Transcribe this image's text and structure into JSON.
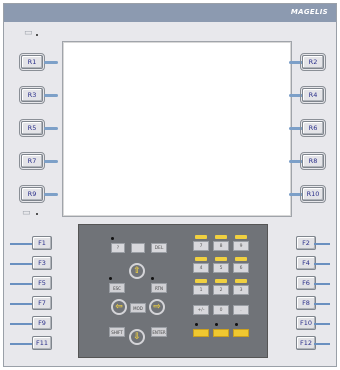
{
  "brand": "MAGELIS",
  "icons": {
    "screen_icon": "display-icon",
    "keyboard_icon": "keyboard-icon"
  },
  "colors": {
    "topbar": "#8c9ab0",
    "keypad": "#707378",
    "cable": "#7da0c8",
    "yellow_key": "#f0d040"
  },
  "right_keys": {
    "left": [
      "R1",
      "R3",
      "R5",
      "R7",
      "R9"
    ],
    "right": [
      "R2",
      "R4",
      "R6",
      "R8",
      "R10"
    ]
  },
  "function_keys": {
    "left": [
      "F1",
      "F3",
      "F5",
      "F7",
      "F9",
      "F11"
    ],
    "right": [
      "F2",
      "F4",
      "F6",
      "F8",
      "F10",
      "F12"
    ]
  },
  "keypad": {
    "top_row": [
      "?",
      "",
      "DEL"
    ],
    "digits": [
      "7",
      "8",
      "9",
      "4",
      "5",
      "6",
      "1",
      "2",
      "3",
      "+/-",
      "0",
      "."
    ],
    "nav": [
      "ESC",
      "MOD",
      "RTN",
      "SHIFT",
      "ENTER"
    ],
    "yellow_row": [
      "",
      "",
      ""
    ]
  }
}
